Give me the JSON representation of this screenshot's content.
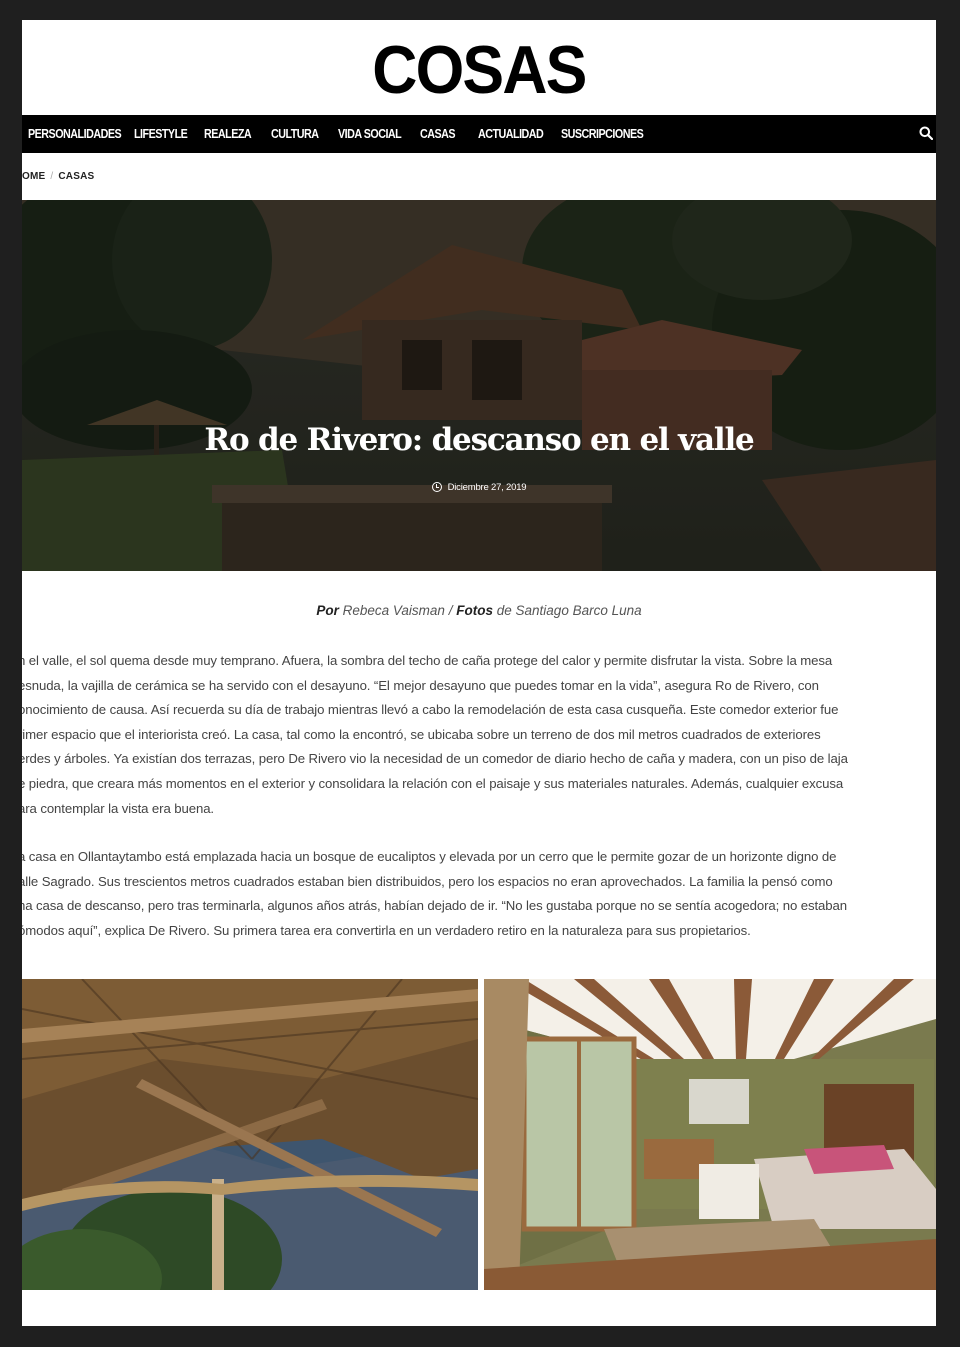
{
  "brand": {
    "logo": "COSAS"
  },
  "nav": {
    "items": [
      {
        "label": "PERSONALIDADES"
      },
      {
        "label": "LIFESTYLE"
      },
      {
        "label": "REALEZA"
      },
      {
        "label": "CULTURA"
      },
      {
        "label": "VIDA SOCIAL"
      },
      {
        "label": "CASAS"
      },
      {
        "label": "ACTUALIDAD"
      },
      {
        "label": "SUSCRIPCIONES"
      }
    ],
    "search_icon": "search-icon"
  },
  "breadcrumb": {
    "home": "OME",
    "separator": "/",
    "current": "CASAS"
  },
  "hero": {
    "title": "Ro de Rivero: descanso en el valle",
    "date": "Diciembre 27, 2019",
    "date_icon": "clock-icon"
  },
  "byline": {
    "por_label": "Por",
    "author": "Rebeca Vaisman",
    "separator": "/",
    "fotos_label": "Fotos",
    "photographer": "de Santiago Barco Luna"
  },
  "article": {
    "paragraph1": [
      "n el valle, el sol quema desde muy temprano. Afuera, la sombra del techo de caña protege del calor y permite disfrutar la vista. Sobre la mesa",
      "esnuda, la vajilla de cerámica se ha servido con el desayuno. “El mejor desayuno que puedes tomar en la vida”, asegura Ro de Rivero, con",
      "onocimiento de causa. Así recuerda su día de trabajo mientras llevó a cabo la remodelación de esta casa cusqueña. Este comedor exterior fue",
      "rimer espacio que el interiorista creó. La casa, tal como la encontró, se ubicaba sobre un terreno de dos mil metros cuadrados de exteriores",
      "erdes y árboles. Ya existían dos terrazas, pero De Rivero vio la necesidad de un comedor de diario hecho de caña y madera, con un piso de laja",
      "e piedra, que creara más momentos en el exterior y consolidara la relación con el paisaje y sus materiales naturales. Además, cualquier excusa",
      "ara contemplar la vista era buena."
    ],
    "paragraph2": [
      "a casa en Ollantaytambo está emplazada hacia un bosque de eucaliptos y elevada por un cerro que le permite gozar de un horizonte digno de",
      "alle Sagrado. Sus trescientos metros cuadrados estaban bien distribuidos, pero los espacios no eran aprovechados. La familia la pensó como",
      "na casa de descanso, pero tras terminarla, algunos años atrás, habían dejado de ir. “No les gustaba porque no se sentía acogedora; no estaban",
      "ómodos aquí”, explica De Rivero. Su primera tarea era convertirla en un verdadero retiro en la naturaleza para sus propietarios."
    ]
  }
}
